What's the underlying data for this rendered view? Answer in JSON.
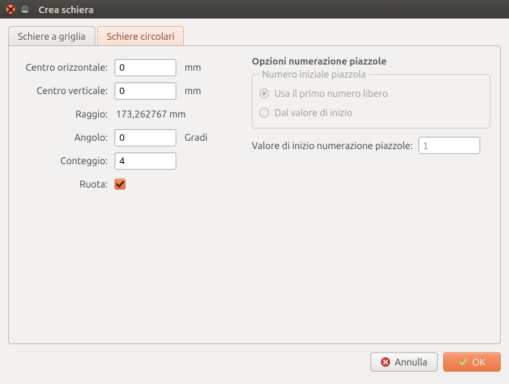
{
  "window": {
    "title": "Crea schiera"
  },
  "tabs": {
    "grid": {
      "label": "Schiere a griglia"
    },
    "circular": {
      "label": "Schiere circolari"
    }
  },
  "form": {
    "hcenter": {
      "label": "Centro orizzontale:",
      "value": "0",
      "unit": "mm"
    },
    "vcenter": {
      "label": "Centro verticale:",
      "value": "0",
      "unit": "mm"
    },
    "radius": {
      "label": "Raggio:",
      "value": "173,262767 mm"
    },
    "angle": {
      "label": "Angolo:",
      "value": "0",
      "unit": "Gradi"
    },
    "count": {
      "label": "Conteggio:",
      "value": "4"
    },
    "rotate": {
      "label": "Ruota:",
      "checked": true
    }
  },
  "pad_options": {
    "title": "Opzioni numerazione piazzole",
    "group_label": "Numero iniziale piazzola",
    "radio_first_free": "Usa il primo numero libero",
    "radio_from_start": "Dal valore di inizio",
    "start_label": "Valore di inizio numerazione piazzole:",
    "start_value": "1"
  },
  "buttons": {
    "cancel": "Annulla",
    "ok": "OK"
  }
}
